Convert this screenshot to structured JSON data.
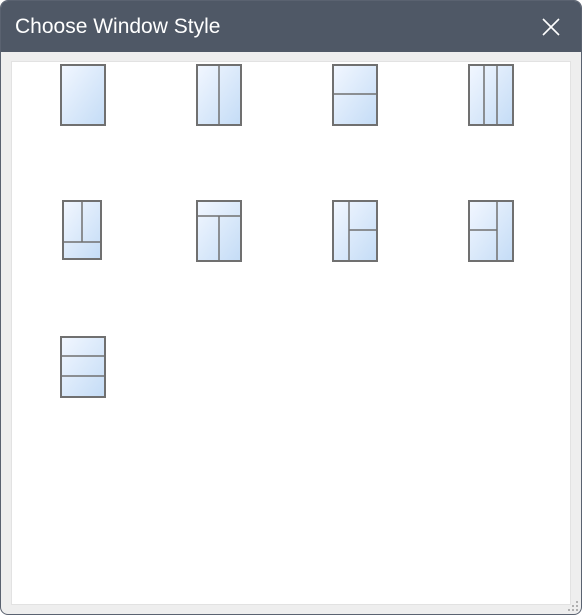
{
  "dialog": {
    "title": "Choose Window Style",
    "close_icon": "close-icon",
    "resize_icon": "resize-grip-icon"
  },
  "colors": {
    "titlebar": "#4f5866",
    "pane_light": "#f2f7ff",
    "pane_dark": "#c4dcf6",
    "frame": "#707070"
  },
  "window_styles": [
    {
      "id": "single-pane"
    },
    {
      "id": "two-vertical-panes"
    },
    {
      "id": "two-horizontal-panes"
    },
    {
      "id": "three-vertical-panes"
    },
    {
      "id": "tall-split-top-left-right-bottom-full"
    },
    {
      "id": "top-full-bottom-split"
    },
    {
      "id": "left-full-right-split"
    },
    {
      "id": "left-split-right-full"
    },
    {
      "id": "three-horizontal-panes"
    }
  ]
}
